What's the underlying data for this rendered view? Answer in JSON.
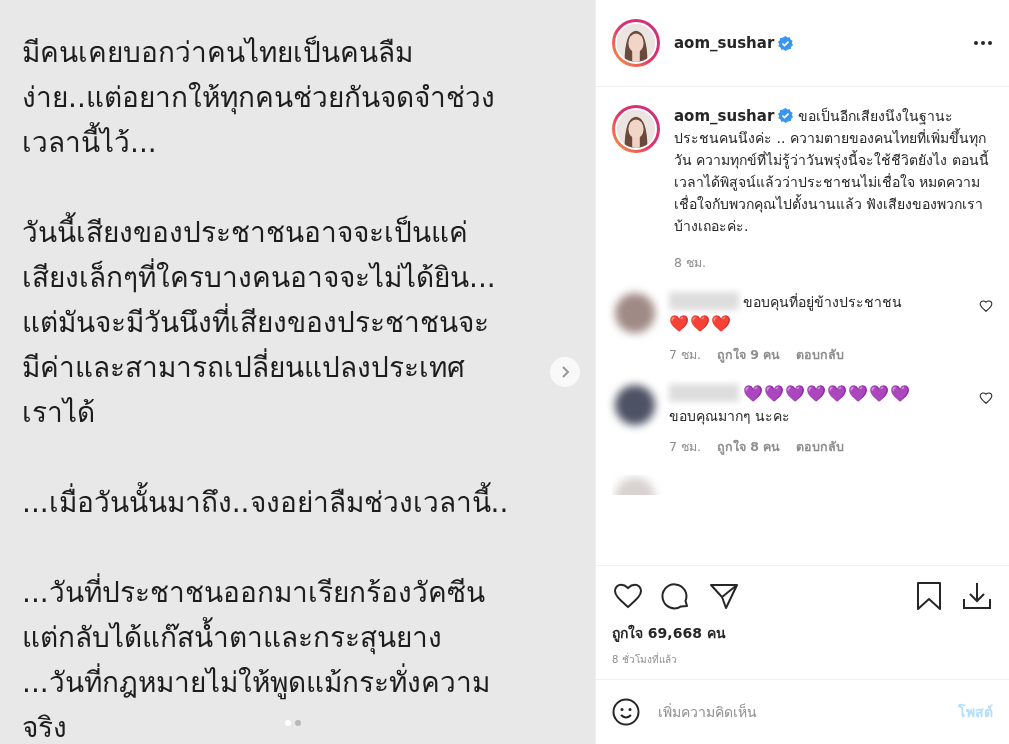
{
  "slide": {
    "paragraphs": [
      [
        "มีคนเคยบอกว่าคนไทยเป็นคนลืม",
        "ง่าย..แต่อยากให้ทุกคนช่วยกันจดจำช่วง",
        "เวลานี้ไว้..."
      ],
      [
        "วันนี้เสียงของประชาชนอาจจะเป็นแค่",
        "เสียงเล็กๆที่ใครบางคนอาจจะไม่ได้ยิน...",
        "แต่มันจะมีวันนึงที่เสียงของประชาชนจะ",
        "มีค่าและสามารถเปลี่ยนแปลงประเทศ",
        "เราได้"
      ],
      [
        "...เมื่อวันนั้นมาถึง..จงอย่าลืมช่วงเวลานี้.."
      ],
      [
        "...วันที่ประชาชนออกมาเรียกร้องวัคซีน",
        "แต่กลับได้แก๊สน้ำตาและกระสุนยาง",
        "...วันที่กฎหมายไม่ให้พูดแม้กระทั่งความ",
        "จริง"
      ]
    ],
    "dots": [
      {
        "selected": true
      },
      {
        "selected": false
      }
    ]
  },
  "header": {
    "username": "aom_sushar",
    "verified": true
  },
  "caption": {
    "username": "aom_sushar",
    "verified": true,
    "text": "ขอเป็นอีกเสียงนึงในฐานะประชนคนนึงค่ะ .. ความตายของคนไทยที่เพิ่มขึ้นทุกวัน ความทุกข์ที่ไม่รู้ว่าวันพรุ่งนี้จะใช้ชีวิตยังไง ตอนนี้เวลาได้พิสูจน์แล้วว่าประชาชนไม่เชื่อใจ หมดความเชื่อใจกับพวกคุณไปตั้งนานแล้ว ฟังเสียงของพวกเราบ้างเถอะค่ะ.",
    "time": "8 ชม."
  },
  "comments": [
    {
      "text": "ขอบคุนที่อยู่ข้างประชาชน",
      "emoji": "❤️❤️❤️",
      "emoji_first": false,
      "color": "#a08a86",
      "time": "7 ชม.",
      "likes": "ถูกใจ 9 คน",
      "reply": "ตอบกลับ"
    },
    {
      "text": "ขอบคุณมากๆ นะคะ",
      "emoji": "💜💜💜💜💜💜💜💜",
      "emoji_first": true,
      "color": "#4d5264",
      "time": "7 ชม.",
      "likes": "ถูกใจ 8 คน",
      "reply": "ตอบกลับ"
    }
  ],
  "likes": "ถูกใจ 69,668 คน",
  "posted": "8 ชั่วโมงที่แล้ว",
  "comment_box": {
    "placeholder": "เพิ่มความคิดเห็น",
    "post": "โพสต์"
  }
}
